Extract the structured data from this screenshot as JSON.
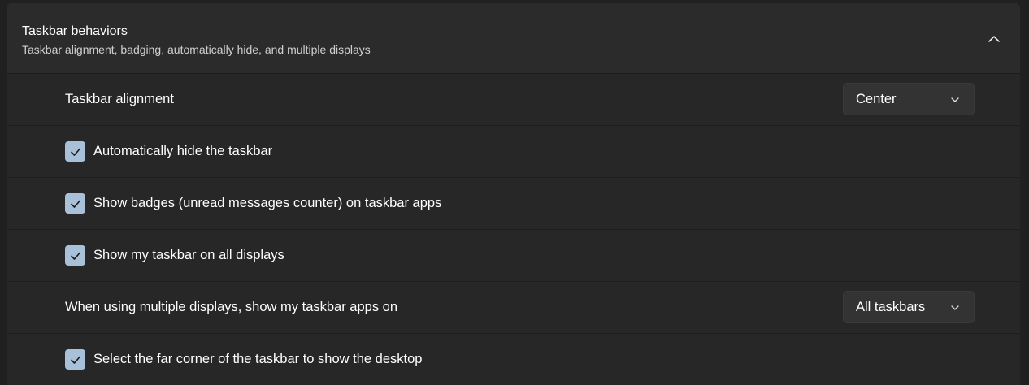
{
  "section": {
    "title": "Taskbar behaviors",
    "subtitle": "Taskbar alignment, badging, automatically hide, and multiple displays",
    "collapse_icon": "chevron-up-icon"
  },
  "settings": {
    "alignment": {
      "label": "Taskbar alignment",
      "value": "Center"
    },
    "auto_hide": {
      "label": "Automatically hide the taskbar",
      "checked": true
    },
    "badges": {
      "label": "Show badges (unread messages counter) on taskbar apps",
      "checked": true
    },
    "all_displays": {
      "label": "Show my taskbar on all displays",
      "checked": true
    },
    "multi_display_apps": {
      "label": "When using multiple displays, show my taskbar apps on",
      "value": "All taskbars"
    },
    "far_corner": {
      "label": "Select the far corner of the taskbar to show the desktop",
      "checked": true
    }
  },
  "colors": {
    "checkbox_accent": "#a8c0d8",
    "panel_bg": "#2b2b2b",
    "row_bg": "#272727"
  }
}
